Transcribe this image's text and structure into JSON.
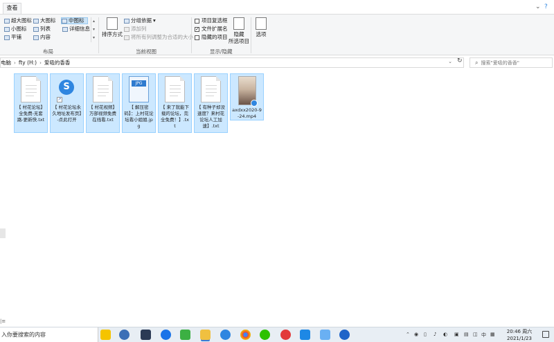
{
  "ribbon": {
    "tab_view": "查看",
    "layout": {
      "items": [
        "超大图标",
        "大图标",
        "中图标",
        "小图标",
        "列表",
        "详细信息",
        "平铺",
        "内容"
      ],
      "label": "布局"
    },
    "current_view": {
      "sort_by": "排序方式",
      "group_by": "分组依据",
      "add_column": "添加列",
      "fit_columns": "将所有列调整为合适的大小",
      "label": "当前视图"
    },
    "show_hide": {
      "item_checkboxes": "项目复选框",
      "file_extensions": "文件扩展名",
      "hidden_items": "隐藏的项目",
      "hide_selected": [
        "隐藏",
        "所选项目"
      ],
      "label": "显示/隐藏"
    },
    "options": "选项"
  },
  "address": {
    "crumbs": [
      "电脑",
      "fty (H:)",
      "爱吸的香香"
    ]
  },
  "search": {
    "placeholder": "搜索\"爱吸的香香\""
  },
  "files": [
    {
      "name": "【 村花论坛】全免费-无套路-更新快.txt",
      "type": "txt"
    },
    {
      "name": "【 村花论坛永久地址发布页】-点此打开",
      "type": "app"
    },
    {
      "name": "【 村花视频】万部视频免费在线看.txt",
      "type": "txt"
    },
    {
      "name": "【 解压密码】：上村花论坛看小姐姐.jpg",
      "type": "jpg"
    },
    {
      "name": "【 来了就能下载的论坛，完全免费！】.txt",
      "type": "txt"
    },
    {
      "name": "【 有种子却没速度？来村花论坛人工加速】.txt",
      "type": "txt"
    },
    {
      "name": "axdxx2020-9-24.mp4",
      "type": "video"
    }
  ],
  "jpg_badge": "JPG",
  "taskbar": {
    "search_text": "入你要搜索的内容",
    "tray_lang": "中",
    "time": "20:46 周六",
    "date": "2021/1/23"
  },
  "colors": {
    "selection": "#cce8ff",
    "selection_border": "#99d1ff",
    "accent": "#2f86e0"
  }
}
